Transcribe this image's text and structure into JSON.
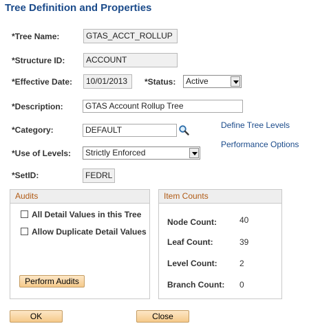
{
  "page": {
    "title": "Tree Definition and Properties"
  },
  "fields": {
    "tree_name": {
      "label": "*Tree Name:",
      "value": "GTAS_ACCT_ROLLUP"
    },
    "structure_id": {
      "label": "*Structure ID:",
      "value": "ACCOUNT"
    },
    "effective_date": {
      "label": "*Effective Date:",
      "value": "10/01/2013"
    },
    "status": {
      "label": "*Status:",
      "value": "Active"
    },
    "description": {
      "label": "*Description:",
      "value": "GTAS Account Rollup Tree"
    },
    "category": {
      "label": "*Category:",
      "value": "DEFAULT"
    },
    "use_of_levels": {
      "label": "*Use of Levels:",
      "value": "Strictly Enforced"
    },
    "setid": {
      "label": "*SetID:",
      "value": "FEDRL"
    }
  },
  "links": {
    "define_tree_levels": "Define Tree Levels",
    "performance_options": "Performance Options"
  },
  "audits": {
    "title": "Audits",
    "checkboxes": [
      {
        "label": "All Detail Values in this Tree",
        "checked": false
      },
      {
        "label": "Allow Duplicate Detail Values",
        "checked": false
      }
    ],
    "perform_button": "Perform Audits"
  },
  "item_counts": {
    "title": "Item Counts",
    "rows": [
      {
        "label": "Node Count:",
        "value": "40"
      },
      {
        "label": "Leaf Count:",
        "value": "39"
      },
      {
        "label": "Level Count:",
        "value": "2"
      },
      {
        "label": "Branch Count:",
        "value": "0"
      }
    ]
  },
  "buttons": {
    "ok": "OK",
    "close": "Close"
  },
  "icons": {
    "lookup": "magnifier-icon"
  },
  "colors": {
    "title": "#1a4a8a",
    "group_header_text": "#b05a14",
    "button_fill": "#f5c98a"
  }
}
